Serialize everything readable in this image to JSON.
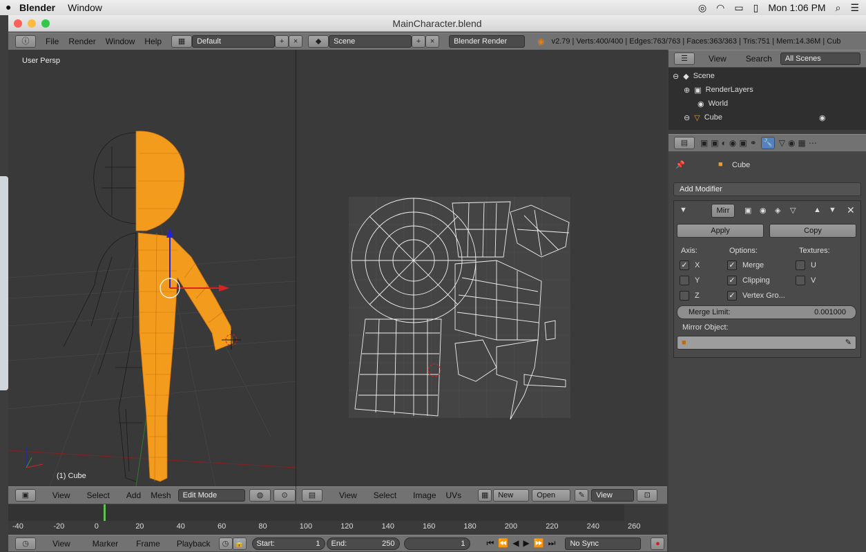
{
  "mac": {
    "app": "Blender",
    "menu": "Window",
    "clock": "Mon 1:06 PM"
  },
  "window": {
    "title": "MainCharacter.blend"
  },
  "info": {
    "menus": [
      "File",
      "Render",
      "Window",
      "Help"
    ],
    "layout": "Default",
    "scene": "Scene",
    "engine": "Blender Render",
    "stats": "v2.79 | Verts:400/400 | Edges:763/763 | Faces:363/363 | Tris:751 | Mem:14.36M | Cub"
  },
  "view3d": {
    "label": "User Persp",
    "object_label": "(1) Cube",
    "menus": [
      "View",
      "Select",
      "Add",
      "Mesh"
    ],
    "mode": "Edit Mode"
  },
  "uv": {
    "menus": [
      "View",
      "Select",
      "Image",
      "UVs"
    ],
    "new": "New",
    "open": "Open",
    "view": "View"
  },
  "outliner": {
    "menus": [
      "View",
      "Search"
    ],
    "filter": "All Scenes",
    "items": [
      "Scene",
      "RenderLayers",
      "World",
      "Cube"
    ]
  },
  "properties": {
    "object": "Cube",
    "add_modifier": "Add Modifier",
    "modifier_name": "Mirr",
    "apply": "Apply",
    "copy": "Copy",
    "axis_label": "Axis:",
    "options_label": "Options:",
    "textures_label": "Textures:",
    "axis": [
      {
        "label": "X",
        "checked": true
      },
      {
        "label": "Y",
        "checked": false
      },
      {
        "label": "Z",
        "checked": false
      }
    ],
    "options": [
      {
        "label": "Merge",
        "checked": true
      },
      {
        "label": "Clipping",
        "checked": true
      },
      {
        "label": "Vertex Gro...",
        "checked": true
      }
    ],
    "textures": [
      {
        "label": "U",
        "checked": false
      },
      {
        "label": "V",
        "checked": false
      }
    ],
    "merge_limit_label": "Merge Limit:",
    "merge_limit_value": "0.001000",
    "mirror_object_label": "Mirror Object:"
  },
  "timeline": {
    "ticks": [
      "-40",
      "-20",
      "0",
      "20",
      "40",
      "60",
      "80",
      "100",
      "120",
      "140",
      "160",
      "180",
      "200",
      "220",
      "240",
      "260"
    ],
    "menus": [
      "View",
      "Marker",
      "Frame",
      "Playback"
    ],
    "start_label": "Start:",
    "start": "1",
    "end_label": "End:",
    "end": "250",
    "current": "1",
    "sync": "No Sync"
  },
  "colors": {
    "accent": "#5680c2",
    "selected": "#ffa53a",
    "header": "#727272"
  }
}
